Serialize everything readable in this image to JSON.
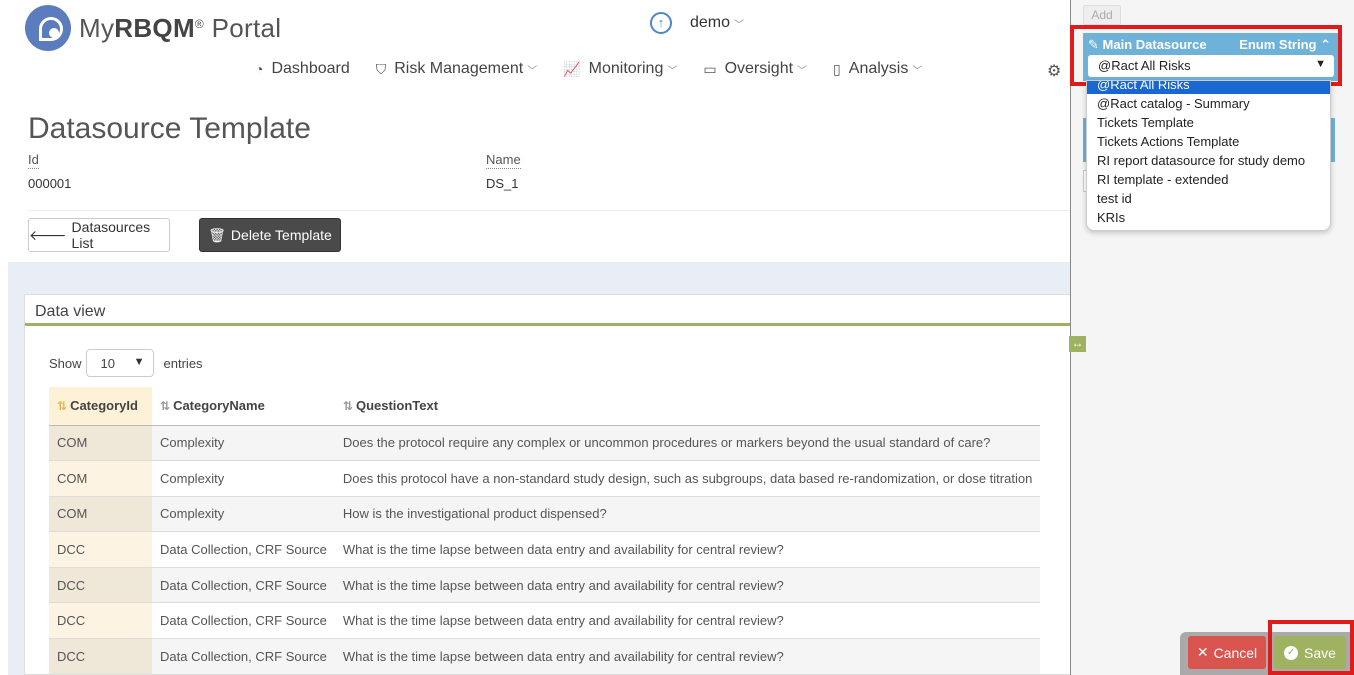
{
  "brand": {
    "prefix": "My",
    "bold": "RBQM",
    "reg": "®",
    "suffix": " Portal"
  },
  "user": {
    "name": "demo"
  },
  "nav": [
    {
      "label": "Dashboard",
      "icon": "dashboard-icon",
      "glyph": "◔",
      "dropdown": false
    },
    {
      "label": "Risk Management",
      "icon": "risk-icon",
      "glyph": "⛉",
      "dropdown": true
    },
    {
      "label": "Monitoring",
      "icon": "chart-icon",
      "glyph": "📈",
      "dropdown": true
    },
    {
      "label": "Oversight",
      "icon": "ticket-icon",
      "glyph": "▭",
      "dropdown": true
    },
    {
      "label": "Analysis",
      "icon": "document-icon",
      "glyph": "▯",
      "dropdown": true
    }
  ],
  "page": {
    "title": "Datasource Template",
    "id_label": "Id",
    "id_value": "000001",
    "name_label": "Name",
    "name_value": "DS_1",
    "back_button": "Datasources List",
    "delete_button": "Delete Template"
  },
  "dataview": {
    "title": "Data view",
    "show_label": "Show",
    "entries_label": "entries",
    "page_length": "10",
    "columns": [
      "CategoryId",
      "CategoryName",
      "QuestionText"
    ],
    "rows": [
      [
        "COM",
        "Complexity",
        "Does the protocol require any complex or uncommon procedures or markers beyond the usual standard of care?"
      ],
      [
        "COM",
        "Complexity",
        "Does this protocol have a non-standard study design, such as subgroups, data based re-randomization, or dose titration"
      ],
      [
        "COM",
        "Complexity",
        "How is the investigational product dispensed?"
      ],
      [
        "DCC",
        "Data Collection, CRF Source",
        "What is the time lapse between data entry and availability for central review?"
      ],
      [
        "DCC",
        "Data Collection, CRF Source",
        "What is the time lapse between data entry and availability for central review?"
      ],
      [
        "DCC",
        "Data Collection, CRF Source",
        "What is the time lapse between data entry and availability for central review?"
      ],
      [
        "DCC",
        "Data Collection, CRF Source",
        "What is the time lapse between data entry and availability for central review?"
      ]
    ]
  },
  "side": {
    "add_button": "Add",
    "datasource_title": "Main Datasource",
    "datasource_type": "Enum String",
    "selected": "@Ract All Risks",
    "options": [
      "@Ract All Risks",
      "@Ract catalog - Summary",
      "Tickets Template",
      "Tickets Actions Template",
      "RI report datasource for study demo",
      "RI template - extended",
      "test id",
      "KRIs"
    ],
    "cancel_button": "Cancel",
    "save_button": "Save"
  },
  "colors": {
    "accent_blue": "#6fb2d9",
    "accent_green": "#9fb262",
    "danger": "#d9534f",
    "highlight": "#e01b1b"
  }
}
